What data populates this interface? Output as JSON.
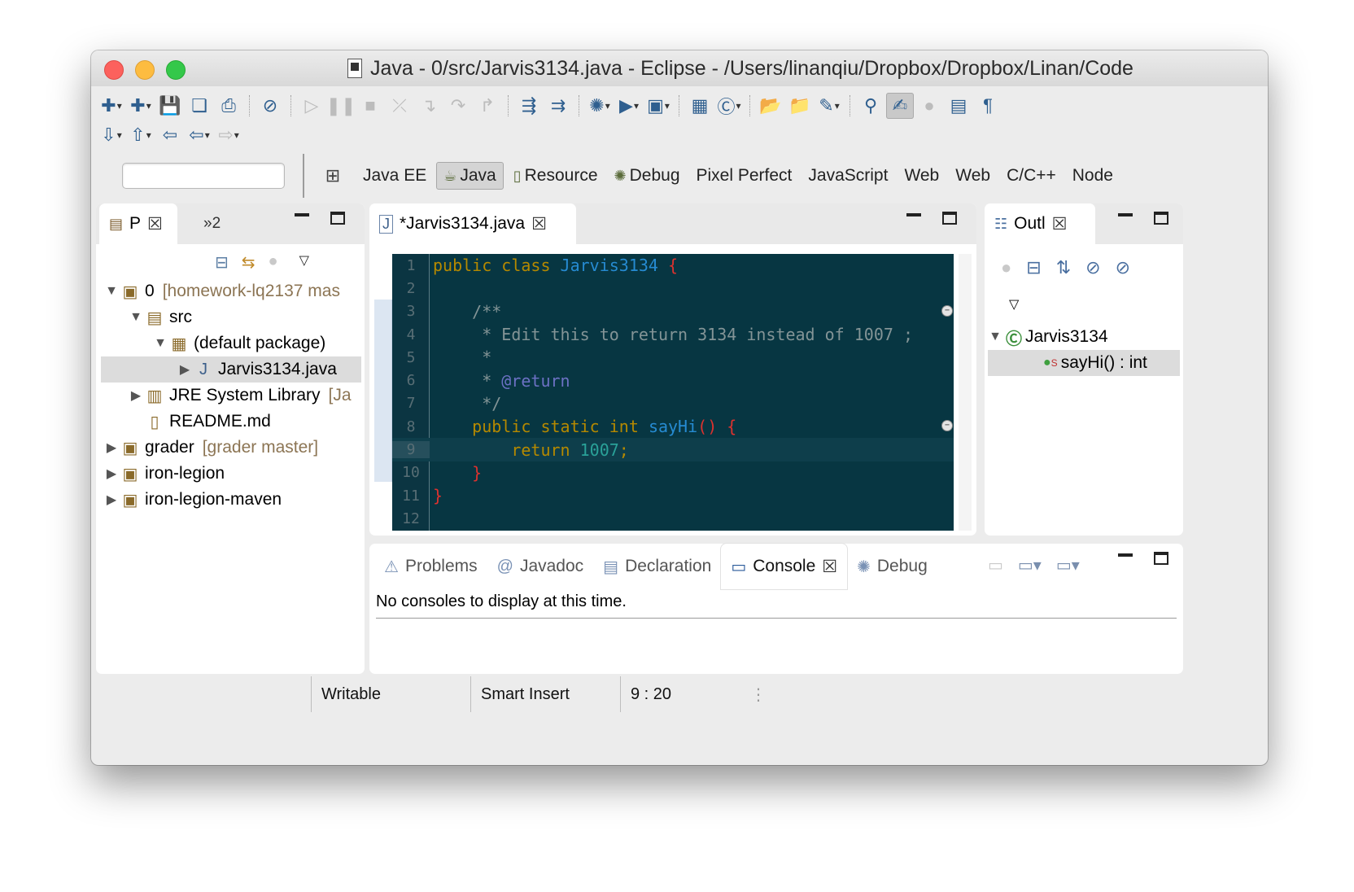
{
  "window": {
    "title": "Java - 0/src/Jarvis3134.java - Eclipse - /Users/linanqiu/Dropbox/Dropbox/Linan/Code"
  },
  "toolbar": {
    "row1": [
      {
        "icon": "new-icon",
        "glyph": "✚",
        "dropdown": true
      },
      {
        "icon": "new-java-icon",
        "glyph": "✚",
        "dropdown": true
      },
      {
        "icon": "save-icon",
        "glyph": "💾"
      },
      {
        "icon": "save-all-icon",
        "glyph": "❏"
      },
      {
        "icon": "print-icon",
        "glyph": "⎙"
      },
      {
        "sep": true
      },
      {
        "icon": "skip-breakpoints-icon",
        "glyph": "⊘"
      },
      {
        "sep": true
      },
      {
        "icon": "resume-icon",
        "glyph": "▷",
        "disabled": true
      },
      {
        "icon": "suspend-icon",
        "glyph": "❚❚",
        "disabled": true
      },
      {
        "icon": "terminate-icon",
        "glyph": "■",
        "disabled": true
      },
      {
        "icon": "disconnect-icon",
        "glyph": "⤫",
        "disabled": true
      },
      {
        "icon": "step-into-icon",
        "glyph": "↴",
        "disabled": true
      },
      {
        "icon": "step-over-icon",
        "glyph": "↷",
        "disabled": true
      },
      {
        "icon": "step-return-icon",
        "glyph": "↱",
        "disabled": true
      },
      {
        "sep": true
      },
      {
        "icon": "drop-to-frame-icon",
        "glyph": "⇶"
      },
      {
        "icon": "use-step-filters-icon",
        "glyph": "⇉"
      },
      {
        "sep": true
      },
      {
        "icon": "debug-icon",
        "glyph": "✺",
        "dropdown": true
      },
      {
        "icon": "run-icon",
        "glyph": "▶",
        "dropdown": true
      },
      {
        "icon": "external-tools-icon",
        "glyph": "▣",
        "dropdown": true
      },
      {
        "sep": true
      },
      {
        "icon": "new-package-icon",
        "glyph": "▦"
      },
      {
        "icon": "new-class-icon",
        "glyph": "Ⓒ",
        "dropdown": true
      },
      {
        "sep": true
      },
      {
        "icon": "open-type-icon",
        "glyph": "📂"
      },
      {
        "icon": "open-resource-icon",
        "glyph": "📁"
      },
      {
        "icon": "search-icon",
        "glyph": "✎",
        "dropdown": true
      },
      {
        "sep": true
      },
      {
        "icon": "toggle-mark-occurrences-icon",
        "glyph": "⚲"
      },
      {
        "icon": "highlight-icon",
        "glyph": "✍",
        "selected": true
      },
      {
        "icon": "toggle-breadcrumb-icon",
        "glyph": "●",
        "disabled": true
      },
      {
        "icon": "block-selection-icon",
        "glyph": "▤"
      },
      {
        "icon": "show-whitespace-icon",
        "glyph": "¶"
      }
    ],
    "row2": [
      {
        "icon": "next-annotation-icon",
        "glyph": "⇩",
        "dropdown": true
      },
      {
        "icon": "previous-annotation-icon",
        "glyph": "⇧",
        "dropdown": true
      },
      {
        "icon": "last-edit-location-icon",
        "glyph": "⇦"
      },
      {
        "icon": "back-icon",
        "glyph": "⇦",
        "dropdown": true
      },
      {
        "icon": "forward-icon",
        "glyph": "⇨",
        "dropdown": true,
        "disabled": true
      }
    ]
  },
  "perspectives": {
    "open_icon": "open-perspective-icon",
    "items": [
      {
        "label": "Java EE",
        "icon": ""
      },
      {
        "label": "Java",
        "icon": "java-perspective-icon",
        "glyph": "☕",
        "active": true
      },
      {
        "label": "Resource",
        "icon": "resource-perspective-icon",
        "glyph": "▯"
      },
      {
        "label": "Debug",
        "icon": "debug-perspective-icon",
        "glyph": "✺"
      },
      {
        "label": "Pixel Perfect",
        "icon": ""
      },
      {
        "label": "JavaScript",
        "icon": ""
      },
      {
        "label": "Web",
        "icon": ""
      },
      {
        "label": "Web",
        "icon": ""
      },
      {
        "label": "C/C++",
        "icon": ""
      },
      {
        "label": "Node",
        "icon": ""
      }
    ]
  },
  "package_explorer": {
    "tab_label": "P",
    "overflow_label": "»2",
    "tree": [
      {
        "indent": 0,
        "twisty": "▼",
        "icon": "project-icon",
        "glyph": "▣",
        "label": "0",
        "extra": "[homework-lq2137 mas"
      },
      {
        "indent": 1,
        "twisty": "▼",
        "icon": "source-folder-icon",
        "glyph": "▤",
        "label": "src",
        "extra": ""
      },
      {
        "indent": 2,
        "twisty": "▼",
        "icon": "package-icon",
        "glyph": "▦",
        "label": "(default package)",
        "extra": ""
      },
      {
        "indent": 3,
        "twisty": "▶",
        "icon": "java-file-icon",
        "glyph": "J",
        "label": "Jarvis3134.java",
        "extra": "",
        "selected": true
      },
      {
        "indent": 1,
        "twisty": "▶",
        "icon": "library-icon",
        "glyph": "▥",
        "label": "JRE System Library",
        "extra": "[Ja"
      },
      {
        "indent": 1,
        "twisty": "",
        "icon": "markdown-file-icon",
        "glyph": "▯",
        "label": "README.md",
        "extra": ""
      },
      {
        "indent": 0,
        "twisty": "▶",
        "icon": "project-icon",
        "glyph": "▣",
        "label": "grader",
        "extra": "[grader master]"
      },
      {
        "indent": 0,
        "twisty": "▶",
        "icon": "project-icon",
        "glyph": "▣",
        "label": "iron-legion",
        "extra": ""
      },
      {
        "indent": 0,
        "twisty": "▶",
        "icon": "maven-project-icon",
        "glyph": "▣",
        "label": "iron-legion-maven",
        "extra": ""
      }
    ]
  },
  "editor": {
    "tab_label": "*Jarvis3134.java",
    "lines": [
      {
        "n": "1",
        "html": "<span class='kw'>public class</span> <span class='cls'>Jarvis3134</span> <span class='br'>{</span>"
      },
      {
        "n": "2",
        "html": ""
      },
      {
        "n": "3",
        "fold": true,
        "html": "    <span class='cm'>/**</span>"
      },
      {
        "n": "4",
        "html": "<span class='cm'>     * Edit this to return 3134 instead of 1007 ;</span>"
      },
      {
        "n": "5",
        "html": "<span class='cm'>     *</span>"
      },
      {
        "n": "6",
        "html": "<span class='cm'>     * </span><span class='ann'>@return</span>"
      },
      {
        "n": "7",
        "html": "<span class='cm'>     */</span>"
      },
      {
        "n": "8",
        "fold": true,
        "html": "    <span class='kw'>public static</span> <span class='ty'>int</span> <span class='cls'>sayHi</span><span class='br'>()</span> <span class='br'>{</span>"
      },
      {
        "n": "9",
        "hl": true,
        "html": "        <span class='kw'>return</span> <span class='num'>1007</span><span class='kw'>;</span>"
      },
      {
        "n": "10",
        "html": "    <span class='br'>}</span>"
      },
      {
        "n": "11",
        "html": "<span class='br'>}</span>"
      },
      {
        "n": "12",
        "html": ""
      }
    ]
  },
  "outline": {
    "tab_label": "Outl",
    "class_name": "Jarvis3134",
    "method_label": "sayHi() : int"
  },
  "bottom": {
    "tabs": [
      {
        "label": "Problems",
        "icon": "problems-icon",
        "glyph": "⚠"
      },
      {
        "label": "Javadoc",
        "icon": "javadoc-icon",
        "glyph": "@"
      },
      {
        "label": "Declaration",
        "icon": "declaration-icon",
        "glyph": "▤"
      },
      {
        "label": "Console",
        "icon": "console-icon",
        "glyph": "▭",
        "active": true
      },
      {
        "label": "Debug",
        "icon": "debug-view-icon",
        "glyph": "✺"
      }
    ],
    "console_message": "No consoles to display at this time."
  },
  "statusbar": {
    "writable": "Writable",
    "insert_mode": "Smart Insert",
    "position": "9 : 20"
  },
  "colors": {
    "editor_bg": "#073642",
    "keyword": "#b58900",
    "class": "#268bd2",
    "bracket": "#dc322f",
    "number": "#2aa198"
  }
}
